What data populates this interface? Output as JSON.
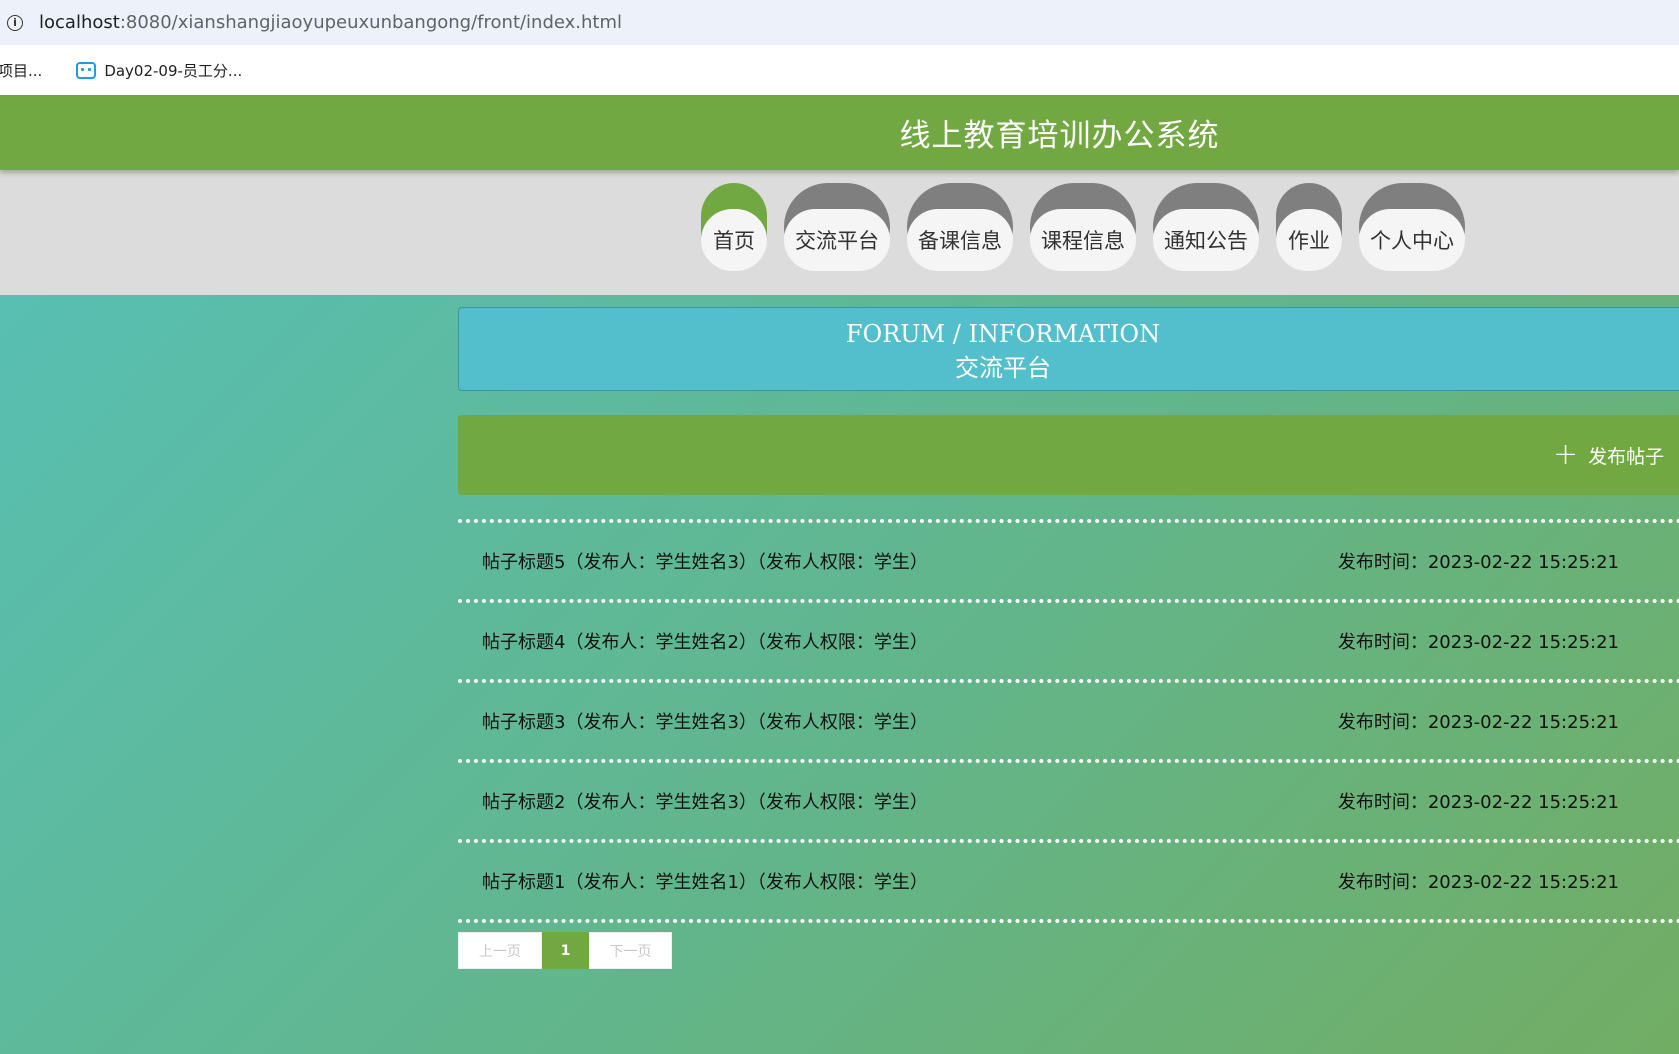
{
  "browser": {
    "url_host": "localhost",
    "url_path": ":8080/xianshangjiaoyupeuxunbangong/front/index.html",
    "bookmarks": [
      {
        "label": "项目..."
      },
      {
        "label": "Day02-09-员工分..."
      }
    ]
  },
  "site": {
    "title": "线上教育培训办公系统"
  },
  "nav": {
    "items": [
      {
        "label": "首页",
        "active": true
      },
      {
        "label": "交流平台",
        "active": false
      },
      {
        "label": "备课信息",
        "active": false
      },
      {
        "label": "课程信息",
        "active": false
      },
      {
        "label": "通知公告",
        "active": false
      },
      {
        "label": "作业",
        "active": false
      },
      {
        "label": "个人中心",
        "active": false
      }
    ]
  },
  "section": {
    "title_en": "FORUM / INFORMATION",
    "title_cn": "交流平台"
  },
  "actions": {
    "publish_label": "发布帖子"
  },
  "posts": [
    {
      "title": "帖子标题5（发布人：学生姓名3）（发布人权限：学生）",
      "time": "发布时间：2023-02-22 15:25:21"
    },
    {
      "title": "帖子标题4（发布人：学生姓名2）（发布人权限：学生）",
      "time": "发布时间：2023-02-22 15:25:21"
    },
    {
      "title": "帖子标题3（发布人：学生姓名3）（发布人权限：学生）",
      "time": "发布时间：2023-02-22 15:25:21"
    },
    {
      "title": "帖子标题2（发布人：学生姓名3）（发布人权限：学生）",
      "time": "发布时间：2023-02-22 15:25:21"
    },
    {
      "title": "帖子标题1（发布人：学生姓名1）（发布人权限：学生）",
      "time": "发布时间：2023-02-22 15:25:21"
    }
  ],
  "pagination": {
    "prev_label": "上一页",
    "current_page": "1",
    "next_label": "下一页"
  },
  "colors": {
    "brand_green": "#72a842",
    "forum_banner": "#53bfcc",
    "nav_inactive": "#7f7f7f"
  }
}
